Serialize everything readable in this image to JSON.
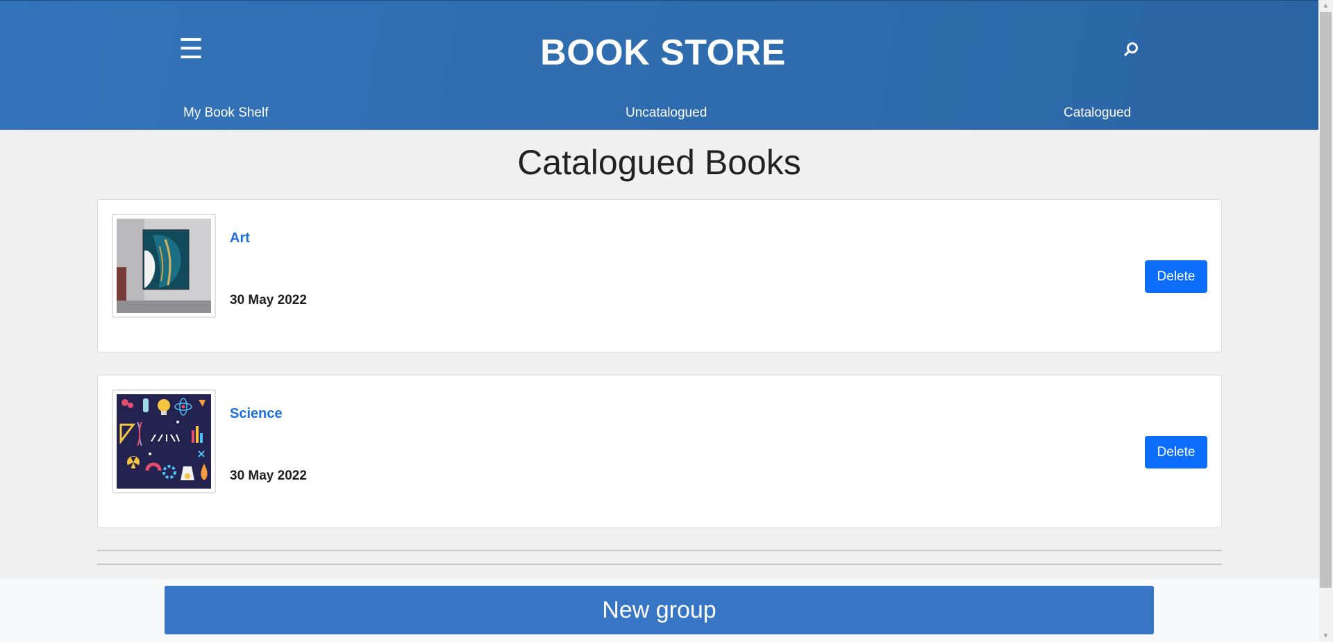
{
  "header": {
    "brand": "BOOK STORE",
    "menu_icon": "hamburger-menu-icon",
    "search_icon": "search-icon",
    "nav": [
      {
        "label": "My Book Shelf"
      },
      {
        "label": "Uncatalogued"
      },
      {
        "label": "Catalogued"
      }
    ]
  },
  "main": {
    "title": "Catalogued Books",
    "books": [
      {
        "title": "Art",
        "date": "30 May 2022",
        "delete_label": "Delete",
        "thumbnail": "art-wall-painting"
      },
      {
        "title": "Science",
        "date": "30 May 2022",
        "delete_label": "Delete",
        "thumbnail": "science-icons-collage"
      }
    ]
  },
  "footer": {
    "new_group_label": "New group"
  },
  "colors": {
    "header_bg": "#3070b4",
    "link": "#1a6ee0",
    "delete_button": "#0d6efd",
    "new_group_button": "#3776c4",
    "page_bg": "#f0f0f0"
  }
}
